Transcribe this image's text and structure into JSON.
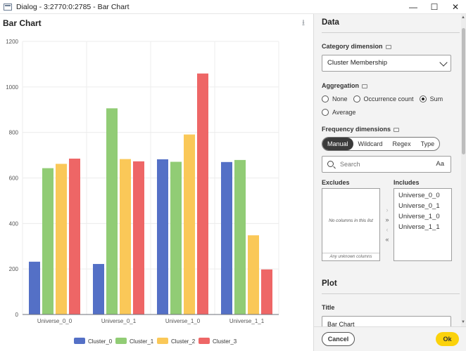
{
  "window": {
    "title": "Dialog - 3:2770:0:2785 - Bar Chart",
    "minimize": "—",
    "maximize": "☐",
    "close": "✕"
  },
  "chart_header": {
    "title": "Bar Chart",
    "download_icon": "download-icon"
  },
  "chart_data": {
    "type": "bar",
    "categories": [
      "Universe_0_0",
      "Universe_0_1",
      "Universe_1_0",
      "Universe_1_1"
    ],
    "series": [
      {
        "name": "Cluster_0",
        "color": "#5470c6",
        "values": [
          232,
          222,
          682,
          670
        ]
      },
      {
        "name": "Cluster_1",
        "color": "#91cc75",
        "values": [
          643,
          906,
          671,
          679
        ]
      },
      {
        "name": "Cluster_2",
        "color": "#fac858",
        "values": [
          662,
          683,
          791,
          348
        ]
      },
      {
        "name": "Cluster_3",
        "color": "#ee6666",
        "values": [
          685,
          673,
          1059,
          198
        ]
      }
    ],
    "yticks": [
      0,
      200,
      400,
      600,
      800,
      1000,
      1200
    ],
    "ylim": [
      0,
      1200
    ],
    "grid": true,
    "legend_position": "bottom-center"
  },
  "panel": {
    "data_section": "Data",
    "category_dimension_label": "Category dimension",
    "category_dimension_value": "Cluster Membership",
    "aggregation_label": "Aggregation",
    "aggregation_options": [
      "None",
      "Occurrence count",
      "Sum",
      "Average"
    ],
    "aggregation_selected": "Sum",
    "frequency_dimensions_label": "Frequency dimensions",
    "modes": [
      "Manual",
      "Wildcard",
      "Regex",
      "Type"
    ],
    "mode_selected": "Manual",
    "search_placeholder": "Search",
    "case_toggle": "Aa",
    "excludes_label": "Excludes",
    "excludes_empty": "No columns in this list",
    "excludes_footer": "Any unknown columns",
    "includes_label": "Includes",
    "includes_items": [
      "Universe_0_0",
      "Universe_0_1",
      "Universe_1_0",
      "Universe_1_1"
    ],
    "plot_section": "Plot",
    "title_label": "Title",
    "title_value": "Bar Chart"
  },
  "footer": {
    "cancel": "Cancel",
    "ok": "Ok"
  }
}
